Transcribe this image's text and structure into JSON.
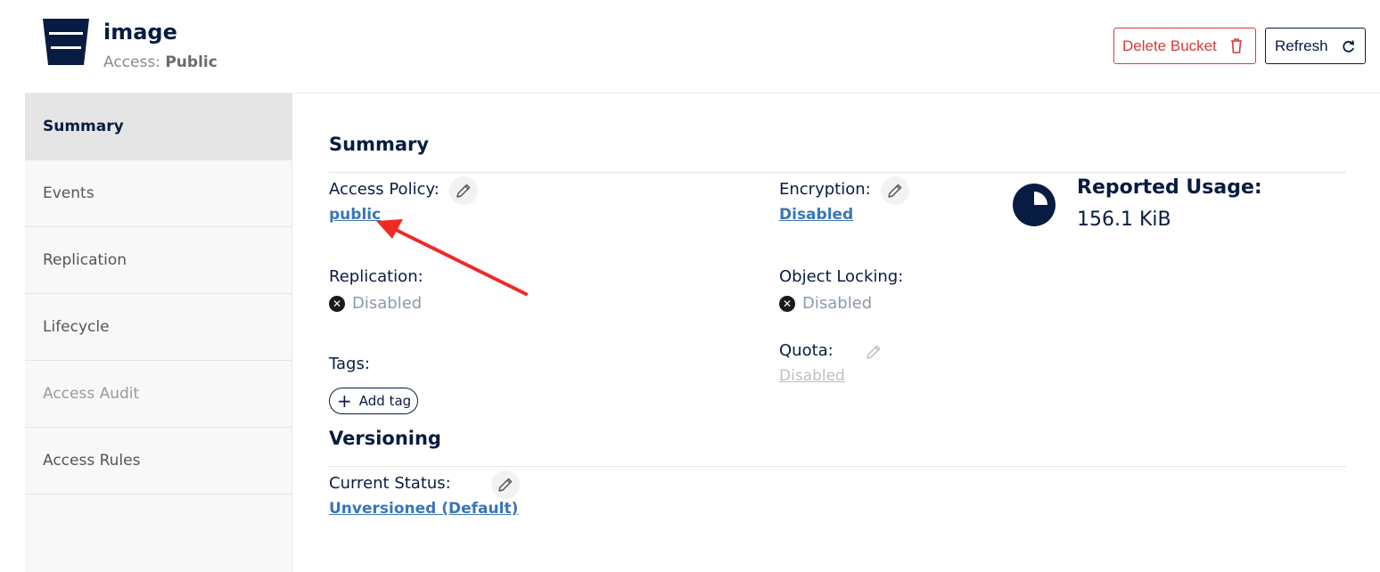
{
  "header": {
    "bucket_name": "image",
    "access_label": "Access:",
    "access_value": "Public",
    "delete_label": "Delete Bucket",
    "refresh_label": "Refresh"
  },
  "sidebar": {
    "items": [
      {
        "label": "Summary",
        "state": "active"
      },
      {
        "label": "Events",
        "state": "normal"
      },
      {
        "label": "Replication",
        "state": "normal"
      },
      {
        "label": "Lifecycle",
        "state": "normal"
      },
      {
        "label": "Access Audit",
        "state": "disabled"
      },
      {
        "label": "Access Rules",
        "state": "normal"
      }
    ]
  },
  "summary": {
    "title": "Summary",
    "access_policy_label": "Access Policy:",
    "access_policy_value": "public",
    "encryption_label": "Encryption:",
    "encryption_value": "Disabled",
    "replication_label": "Replication:",
    "replication_value": "Disabled",
    "object_locking_label": "Object Locking:",
    "object_locking_value": "Disabled",
    "tags_label": "Tags:",
    "add_tag_label": "Add tag",
    "quota_label": "Quota:",
    "quota_value": "Disabled",
    "reported_usage_label": "Reported Usage:",
    "reported_usage_value": "156.1 KiB"
  },
  "versioning": {
    "title": "Versioning",
    "current_status_label": "Current Status:",
    "current_status_value": "Unversioned (Default)"
  },
  "colors": {
    "navy": "#081c42",
    "link": "#3a76b6",
    "danger": "#d93a3a",
    "annotation_arrow": "#ee2a24"
  },
  "icons": [
    "bucket-icon",
    "trash-icon",
    "refresh-icon",
    "pencil-icon",
    "x-circle-icon",
    "plus-icon",
    "pie-chart-icon"
  ]
}
